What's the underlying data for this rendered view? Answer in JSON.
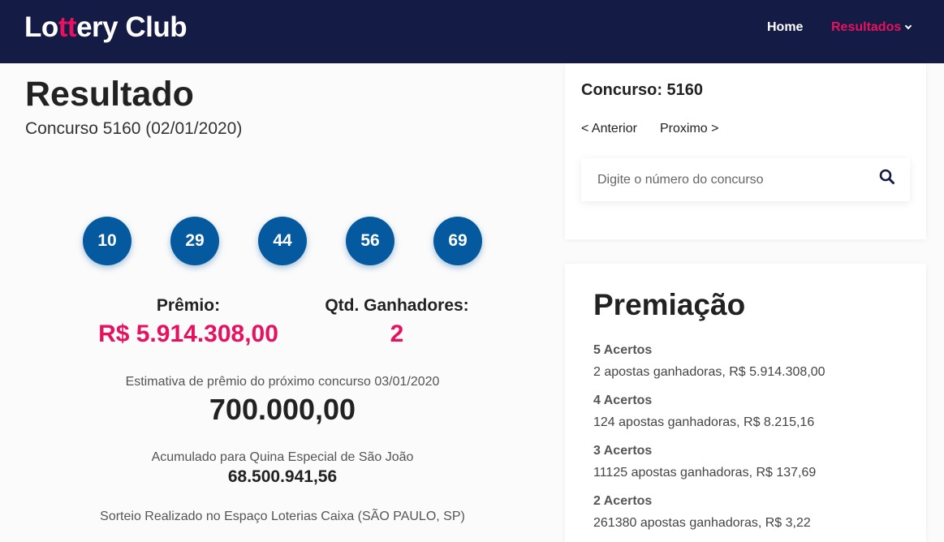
{
  "brand": {
    "prefix": "Lo",
    "accent": "tt",
    "suffix": "ery Club"
  },
  "nav": {
    "home": "Home",
    "results": "Resultados"
  },
  "main": {
    "title": "Resultado",
    "subtitle": "Concurso 5160 (02/01/2020)",
    "numbers": [
      "10",
      "29",
      "44",
      "56",
      "69"
    ],
    "prize_label": "Prêmio:",
    "prize_value": "R$ 5.914.308,00",
    "winners_label": "Qtd. Ganhadores:",
    "winners_value": "2",
    "estimate_label": "Estimativa de prêmio do próximo concurso 03/01/2020",
    "estimate_value": "700.000,00",
    "accum_label": "Acumulado para Quina Especial de São João",
    "accum_value": "68.500.941,56",
    "draw_place": "Sorteio Realizado no Espaço Loterias Caixa (SÃO PAULO, SP)"
  },
  "sidebar": {
    "contest_heading": "Concurso: 5160",
    "prev_label": "< Anterior",
    "next_label": "Proximo >",
    "search_placeholder": "Digite o número do concurso",
    "search_value": "",
    "prizes_title": "Premiação",
    "tiers": [
      {
        "name": "5 Acertos",
        "desc": "2 apostas ganhadoras, R$ 5.914.308,00"
      },
      {
        "name": "4 Acertos",
        "desc": "124 apostas ganhadoras, R$ 8.215,16"
      },
      {
        "name": "3 Acertos",
        "desc": "11125 apostas ganhadoras, R$ 137,69"
      },
      {
        "name": "2 Acertos",
        "desc": "261380 apostas ganhadoras, R$ 3,22"
      }
    ]
  },
  "colors": {
    "navbar": "#141b44",
    "accent": "#e6125f",
    "ball": "#04599f"
  },
  "icons": {
    "search": "search-icon",
    "dropdown": "chevron-down-icon"
  }
}
